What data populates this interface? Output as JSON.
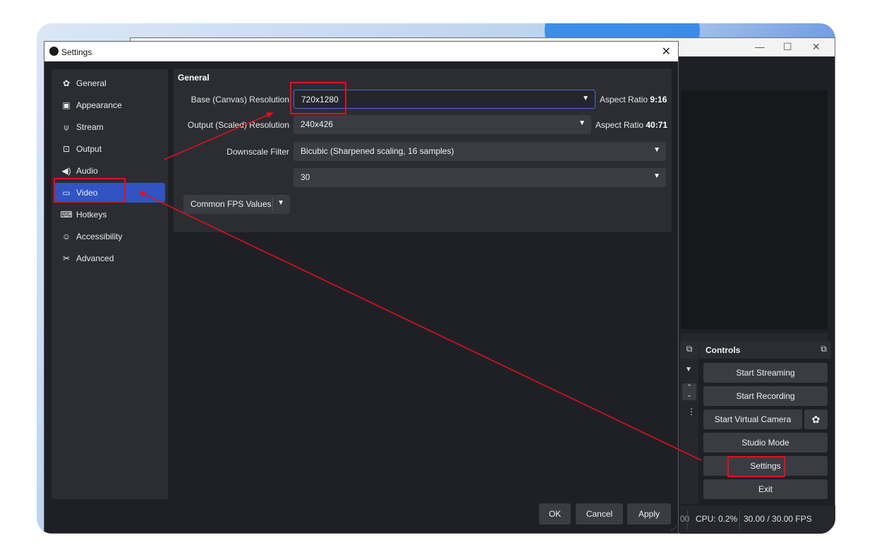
{
  "dialog": {
    "title": "Settings",
    "close_glyph": "✕"
  },
  "sidebar": {
    "items": [
      {
        "label": "General",
        "icon": "gear-icon",
        "glyph": "✿"
      },
      {
        "label": "Appearance",
        "icon": "appearance-icon",
        "glyph": "▣"
      },
      {
        "label": "Stream",
        "icon": "antenna-icon",
        "glyph": "⍦"
      },
      {
        "label": "Output",
        "icon": "output-icon",
        "glyph": "⊡"
      },
      {
        "label": "Audio",
        "icon": "speaker-icon",
        "glyph": "◀)"
      },
      {
        "label": "Video",
        "icon": "monitor-icon",
        "glyph": "▭"
      },
      {
        "label": "Hotkeys",
        "icon": "keyboard-icon",
        "glyph": "⌨"
      },
      {
        "label": "Accessibility",
        "icon": "accessibility-icon",
        "glyph": "☺"
      },
      {
        "label": "Advanced",
        "icon": "tools-icon",
        "glyph": "✂"
      }
    ],
    "active_index": 5
  },
  "general": {
    "title": "General",
    "base_resolution": {
      "label": "Base (Canvas) Resolution",
      "value": "720x1280",
      "aspect_prefix": "Aspect Ratio ",
      "aspect_value": "9:16"
    },
    "output_resolution": {
      "label": "Output (Scaled) Resolution",
      "value": "240x426",
      "aspect_prefix": "Aspect Ratio ",
      "aspect_value": "40:71"
    },
    "downscale_filter": {
      "label": "Downscale Filter",
      "value": "Bicubic (Sharpened scaling, 16 samples)"
    },
    "fps": {
      "type_label": "Common FPS Values",
      "value": "30"
    }
  },
  "footer_buttons": {
    "ok": "OK",
    "cancel": "Cancel",
    "apply": "Apply"
  },
  "main_window": {
    "controls": {
      "title": "Controls",
      "start_streaming": "Start Streaming",
      "start_recording": "Start Recording",
      "start_virtual_camera": "Start Virtual Camera",
      "studio_mode": "Studio Mode",
      "settings": "Settings",
      "exit": "Exit"
    },
    "status": {
      "fragment": "00",
      "cpu": "CPU: 0.2%",
      "fps": "30.00 / 30.00 FPS"
    }
  },
  "colors": {
    "annotation": "#e1111b",
    "active_item": "#3153c4",
    "background": "#1f2026"
  }
}
